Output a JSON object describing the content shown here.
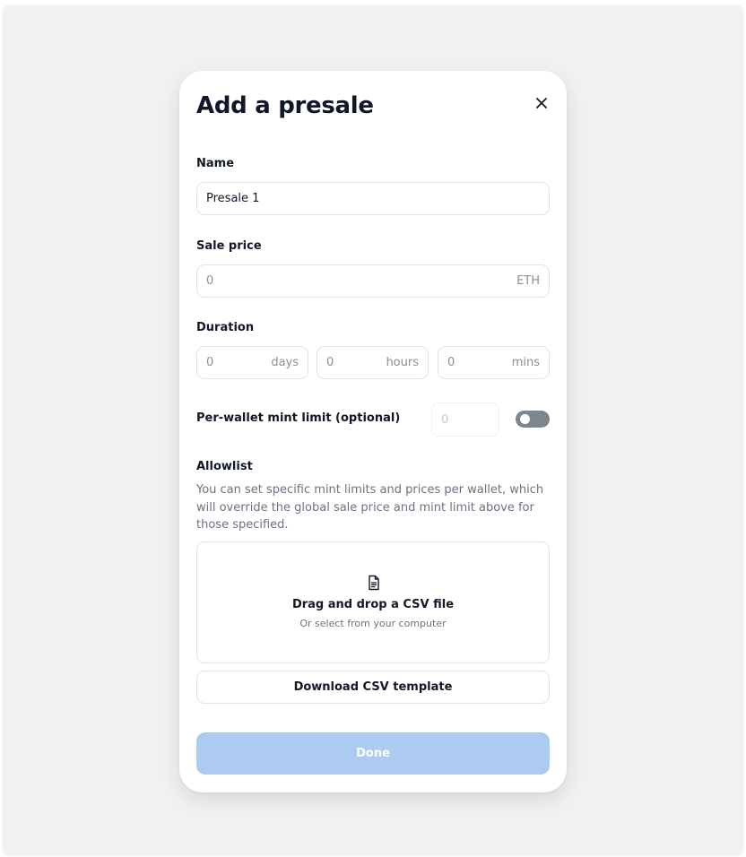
{
  "modal": {
    "title": "Add a presale",
    "close_icon": "close-icon"
  },
  "name": {
    "label": "Name",
    "value": "Presale 1"
  },
  "sale_price": {
    "label": "Sale price",
    "placeholder": "0",
    "unit": "ETH"
  },
  "duration": {
    "label": "Duration",
    "days": {
      "placeholder": "0",
      "unit": "days"
    },
    "hours": {
      "placeholder": "0",
      "unit": "hours"
    },
    "mins": {
      "placeholder": "0",
      "unit": "mins"
    }
  },
  "mint_limit": {
    "label": "Per-wallet mint limit (optional)",
    "placeholder": "0",
    "toggle_on": false
  },
  "allowlist": {
    "label": "Allowlist",
    "description": "You can set specific mint limits and prices per wallet, which will override the global sale price and mint limit above for those specified.",
    "dropzone_icon": "file-icon",
    "dropzone_title": "Drag and drop a CSV file",
    "dropzone_subtitle": "Or select from your computer",
    "download_label": "Download CSV template"
  },
  "actions": {
    "done_label": "Done"
  },
  "colors": {
    "done_disabled": "#adcbf1",
    "toggle_off": "#7d858d",
    "backdrop": "#f1f1f1"
  }
}
